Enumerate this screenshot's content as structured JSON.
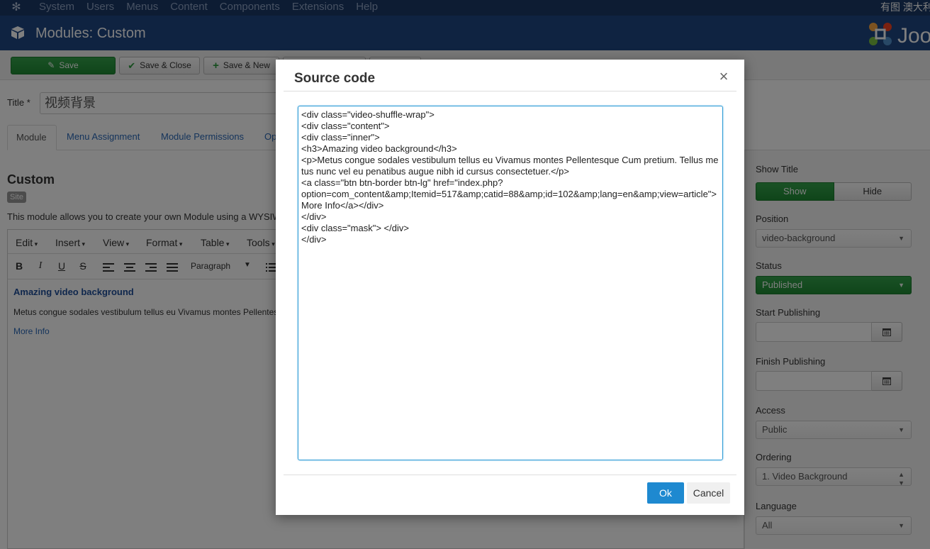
{
  "topnav": {
    "menu": [
      "System",
      "Users",
      "Menus",
      "Content",
      "Components",
      "Extensions",
      "Help"
    ],
    "right_text": "有图 澳大利"
  },
  "header": {
    "title": "Modules: Custom"
  },
  "toolbar": {
    "save": "Save",
    "save_close": "Save & Close",
    "save_new": "Save & New"
  },
  "form": {
    "title_label": "Title *",
    "title_value": "视频背景"
  },
  "tabs": [
    "Module",
    "Menu Assignment",
    "Module Permissions",
    "Op"
  ],
  "module": {
    "heading": "Custom",
    "badge": "Site",
    "description": "This module allows you to create your own Module using a WYSIWYG editor."
  },
  "editor": {
    "menus": [
      "Edit",
      "Insert",
      "View",
      "Format",
      "Table",
      "Tools"
    ],
    "format_tools": {
      "bold": "B",
      "italic": "I",
      "underline": "U",
      "strike": "S"
    },
    "block_format": "Paragraph",
    "content": {
      "heading": "Amazing video background",
      "paragraph": "Metus congue sodales vestibulum tellus eu Vivamus montes Pellentesque Cum pretium.",
      "link": "More Info"
    }
  },
  "sidebar": {
    "show_title_label": "Show Title",
    "show": "Show",
    "hide": "Hide",
    "position_label": "Position",
    "position_value": "video-background",
    "status_label": "Status",
    "status_value": "Published",
    "start_label": "Start Publishing",
    "finish_label": "Finish Publishing",
    "access_label": "Access",
    "access_value": "Public",
    "ordering_label": "Ordering",
    "ordering_value": "1. Video Background",
    "language_label": "Language",
    "language_value": "All"
  },
  "modal": {
    "title": "Source code",
    "source": "<div class=\"video-shuffle-wrap\">\n<div class=\"content\">\n<div class=\"inner\">\n<h3>Amazing video background</h3>\n<p>Metus congue sodales vestibulum tellus eu Vivamus montes Pellentesque Cum pretium. Tellus metus nunc vel eu penatibus augue nibh id cursus consectetuer.</p>\n<a class=\"btn btn-border btn-lg\" href=\"index.php?\noption=com_content&amp;Itemid=517&amp;catid=88&amp;id=102&amp;lang=en&amp;view=article\">More Info</a></div>\n</div>\n<div class=\"mask\"> </div>\n</div>",
    "ok": "Ok",
    "cancel": "Cancel"
  },
  "icons": {
    "joomla": "joomla-logo-icon",
    "module": "cube-icon",
    "save": "edit-icon",
    "check": "check-icon",
    "plus": "plus-icon",
    "close": "close-icon",
    "calendar": "calendar-icon"
  },
  "colors": {
    "nav": "#1a3867",
    "header": "#1f4683",
    "success": "#2a9b3c",
    "primary": "#1e89d0",
    "link": "#2a69b8"
  }
}
